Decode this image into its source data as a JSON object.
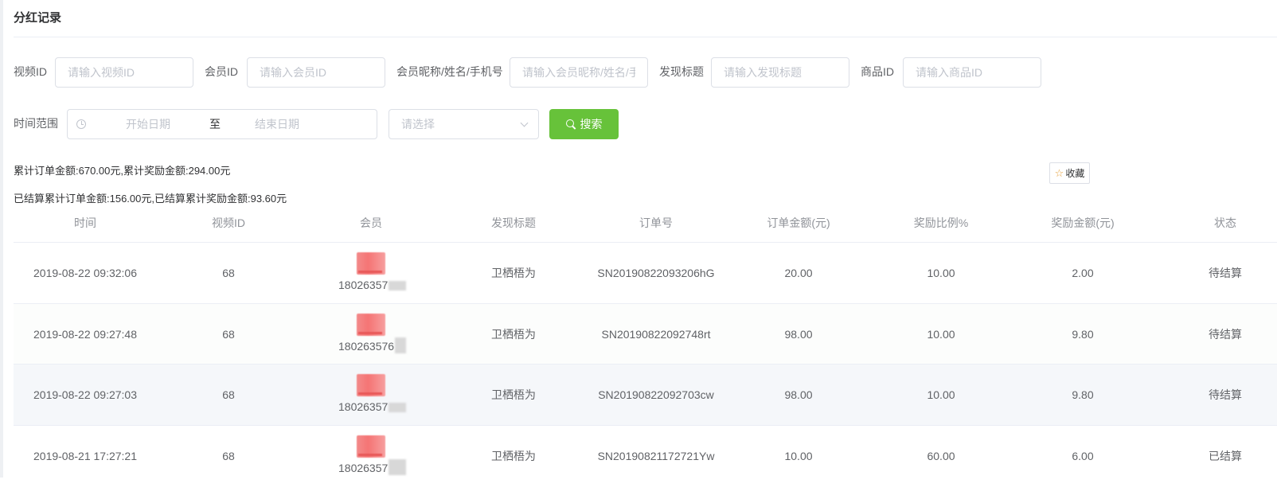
{
  "page": {
    "title": "分红记录"
  },
  "filters": {
    "video_id": {
      "label": "视频ID",
      "placeholder": "请输入视频ID",
      "value": ""
    },
    "member_id": {
      "label": "会员ID",
      "placeholder": "请输入会员ID",
      "value": ""
    },
    "member_name": {
      "label": "会员昵称/姓名/手机号",
      "placeholder": "请输入会员昵称/姓名/手",
      "value": ""
    },
    "discover_title": {
      "label": "发现标题",
      "placeholder": "请输入发现标题",
      "value": ""
    },
    "product_id": {
      "label": "商品ID",
      "placeholder": "请输入商品ID",
      "value": ""
    },
    "time_range": {
      "label": "时间范围",
      "start_placeholder": "开始日期",
      "separator": "至",
      "end_placeholder": "结束日期"
    },
    "status_select": {
      "placeholder": "请选择"
    },
    "search_label": "搜索"
  },
  "summary": {
    "total": "累计订单金额:670.00元,累计奖励金额:294.00元",
    "settled": "已结算累计订单金额:156.00元,已结算累计奖励金额:93.60元"
  },
  "favorite_label": "收藏",
  "table": {
    "columns": [
      "时间",
      "视频ID",
      "会员",
      "发现标题",
      "订单号",
      "订单金额(元)",
      "奖励比例%",
      "奖励金额(元)",
      "状态"
    ],
    "rows": [
      {
        "time": "2019-08-22 09:32:06",
        "video_id": "68",
        "member_phone": "18026357",
        "title": "卫栖梧为",
        "order_no": "SN20190822093206hG",
        "order_amount": "20.00",
        "ratio": "10.00",
        "reward": "2.00",
        "status": "待结算"
      },
      {
        "time": "2019-08-22 09:27:48",
        "video_id": "68",
        "member_phone": "180263576",
        "title": "卫栖梧为",
        "order_no": "SN20190822092748rt",
        "order_amount": "98.00",
        "ratio": "10.00",
        "reward": "9.80",
        "status": "待结算"
      },
      {
        "time": "2019-08-22 09:27:03",
        "video_id": "68",
        "member_phone": "18026357",
        "title": "卫栖梧为",
        "order_no": "SN20190822092703cw",
        "order_amount": "98.00",
        "ratio": "10.00",
        "reward": "9.80",
        "status": "待结算"
      },
      {
        "time": "2019-08-21 17:27:21",
        "video_id": "68",
        "member_phone": "18026357",
        "title": "卫栖梧为",
        "order_no": "SN20190821172721Yw",
        "order_amount": "10.00",
        "ratio": "60.00",
        "reward": "6.00",
        "status": "已结算"
      }
    ]
  },
  "colors": {
    "primary_button": "#67c23a",
    "border": "#dcdfe6",
    "header_text": "#909399",
    "row_highlight": "#f5f7fa"
  }
}
